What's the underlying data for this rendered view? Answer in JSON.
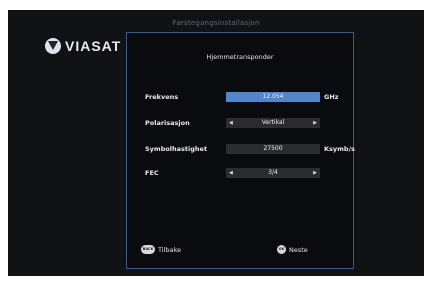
{
  "header": {
    "title": "Førstegangsinstallasjon"
  },
  "logo": {
    "text": "VIASAT"
  },
  "panel": {
    "title": "Hjemmetransponder",
    "rows": [
      {
        "label": "Frekvens",
        "value": "12.054",
        "unit": "GHz"
      },
      {
        "label": "Polarisasjon",
        "value": "Vertikal"
      },
      {
        "label": "Symbolhastighet",
        "value": "27500",
        "unit": "Ksymb/s"
      },
      {
        "label": "FEC",
        "value": "3/4"
      }
    ]
  },
  "footer": {
    "back_key": "BACK",
    "back_label": "Tilbake",
    "ok_key": "OK",
    "next_label": "Neste"
  },
  "colors": {
    "background": "#111215",
    "panel_border": "#3d5a86",
    "selected_field": "#4f86cc",
    "field": "#2b2c30"
  },
  "icons": [
    "viasat-logo-icon",
    "arrow-left-icon",
    "arrow-right-icon",
    "back-key-icon",
    "ok-key-icon"
  ]
}
